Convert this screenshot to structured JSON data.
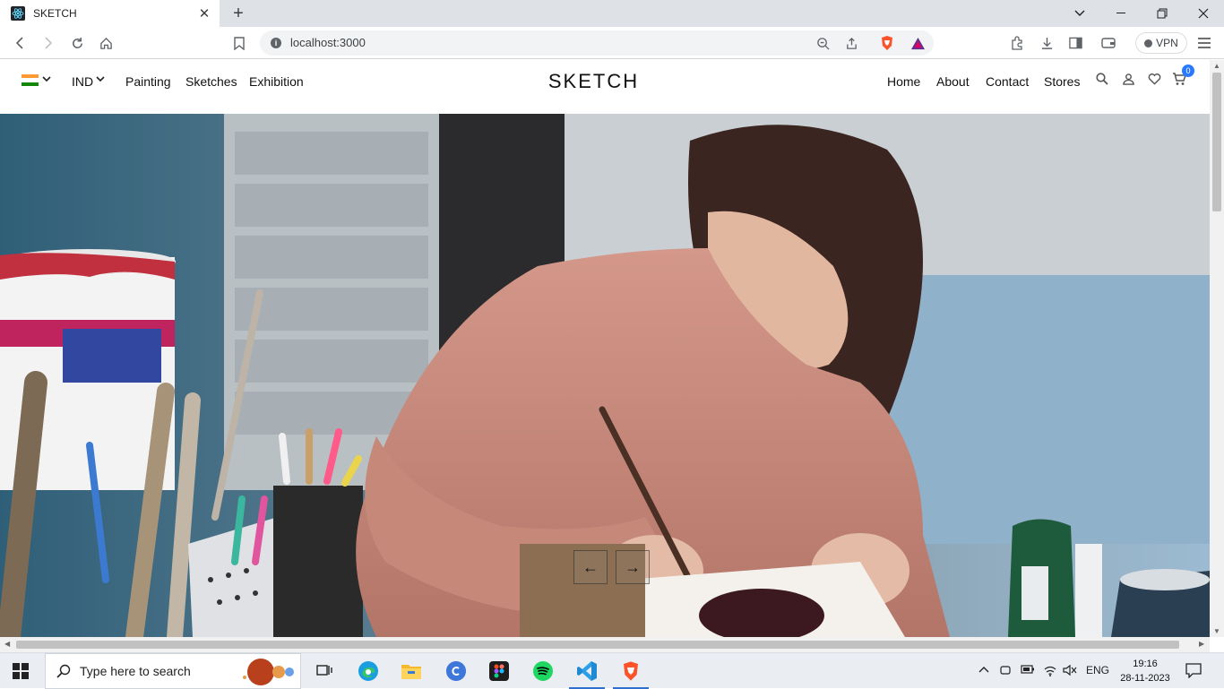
{
  "browser": {
    "tab_title": "SKETCH",
    "url": "localhost:3000",
    "vpn_label": "VPN",
    "colors": {
      "tabstrip": "#dee1e6",
      "brave_orange": "#fb542b",
      "brave_purple": "#662d91"
    }
  },
  "site": {
    "country_flag": "india-flag",
    "currency": "IND",
    "left_nav": [
      "Painting",
      "Sketches",
      "Exhibition"
    ],
    "brand": "SKETCH",
    "right_nav": [
      "Home",
      "About",
      "Contact",
      "Stores"
    ],
    "cart_count": "0",
    "icons": [
      "search-icon",
      "user-icon",
      "heart-icon",
      "cart-icon"
    ],
    "accent": "#2879fe"
  },
  "hero": {
    "image": "woman painting at desk with brushes and paint pots",
    "prev_arrow": "←",
    "next_arrow": "→"
  },
  "taskbar": {
    "search_placeholder": "Type here to search",
    "apps": [
      "task-view-icon",
      "edge-icon",
      "file-explorer-icon",
      "canva-icon",
      "figma-icon",
      "spotify-icon",
      "vscode-icon",
      "brave-icon"
    ],
    "language": "ENG",
    "time": "19:16",
    "date": "28-11-2023"
  }
}
